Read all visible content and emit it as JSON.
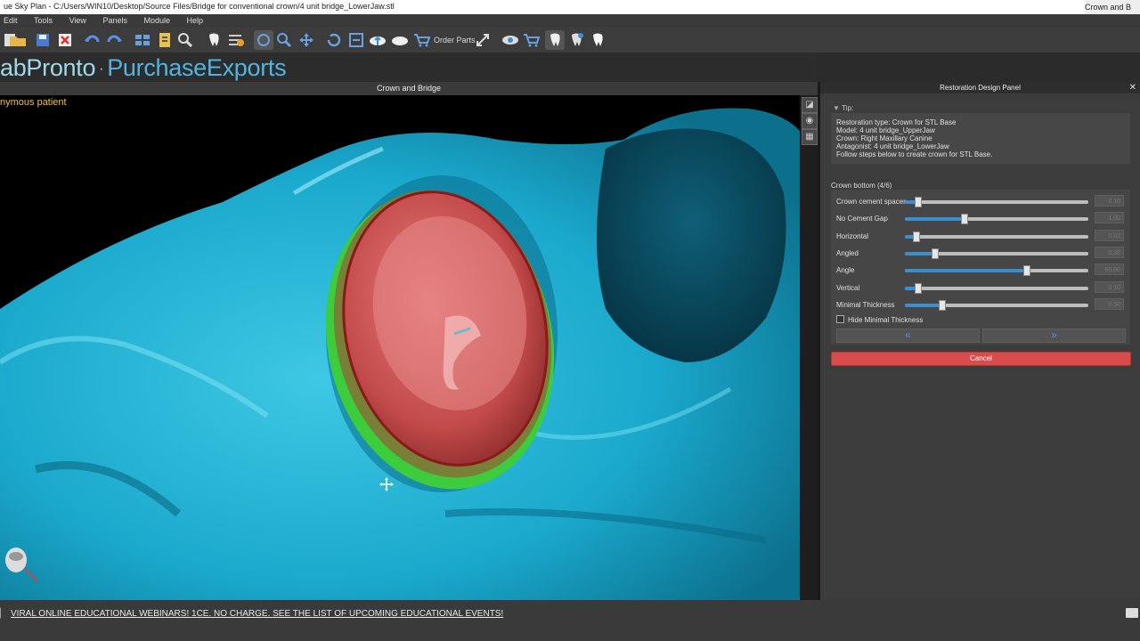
{
  "window": {
    "title": "ue Sky Plan - C:/Users/WIN10/Desktop/Source Files/Bridge for conventional crown/4 unit bridge_LowerJaw.stl",
    "right_tab": "Crown and B",
    "minimize": "–",
    "restore": "❐"
  },
  "menu": {
    "items": [
      "Edit",
      "Tools",
      "View",
      "Panels",
      "Module",
      "Help"
    ]
  },
  "toolbar": {
    "order_parts": "Order Parts"
  },
  "brand": {
    "left": "abPronto",
    "separator": "·",
    "right": "PurchaseExports"
  },
  "viewport": {
    "title": "Crown and Bridge",
    "patient": "nymous patient"
  },
  "panel": {
    "title": "Restoration Design Panel",
    "close": "✕",
    "tip_header": "Tip:",
    "tip_lines": [
      "Restoration type: Crown for STL Base",
      "Model: 4 unit bridge_UpperJaw",
      "Crown: Right Maxillary Canine",
      "Antagonist: 4 unit bridge_LowerJaw",
      "Follow steps below to create crown for STL Base."
    ],
    "section_header": "Crown bottom (4/6)",
    "sliders": [
      {
        "label": "Crown cement spacer",
        "value": "0.10",
        "level": 0.07
      },
      {
        "label": "No Cement Gap",
        "value": "1.00",
        "level": 0.32
      },
      {
        "label": "Horizontal",
        "value": "0.02",
        "level": 0.06
      },
      {
        "label": "Angled",
        "value": "0.30",
        "level": 0.16
      },
      {
        "label": "Angle",
        "value": "60.00",
        "level": 0.66
      },
      {
        "label": "Vertical",
        "value": "0.10",
        "level": 0.07
      },
      {
        "label": "Minimal Thickness",
        "value": "0.50",
        "level": 0.2
      }
    ],
    "hide_min_thickness": "Hide Minimal Thickness",
    "back_icon": "«",
    "next_icon": "»",
    "cancel": "Cancel"
  },
  "bottom": {
    "webinar_text": "VIRAL ONLINE EDUCATIONAL WEBINARS! 1CE. NO CHARGE. SEE THE LIST OF UPCOMING EDUCATIONAL EVENTS!"
  },
  "colors": {
    "model": "#1eb4d6",
    "crown": "#c84848",
    "margin": "#3ccc3c",
    "accent": "#3a8fd1",
    "cancel": "#d84c4c"
  }
}
